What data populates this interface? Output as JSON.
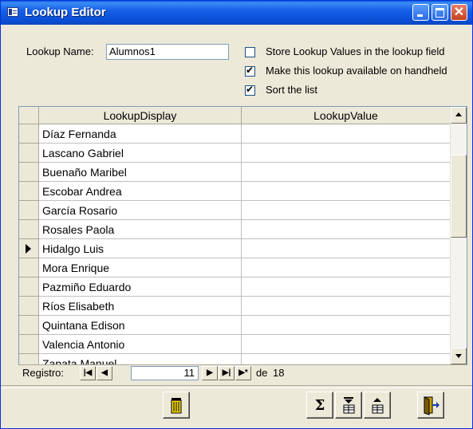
{
  "window": {
    "title": "Lookup Editor"
  },
  "form": {
    "lookup_name_label": "Lookup Name:",
    "lookup_name_value": "Alumnos1",
    "options": [
      {
        "label": "Store Lookup Values in the lookup field",
        "checked": false
      },
      {
        "label": "Make this lookup available on handheld",
        "checked": true
      },
      {
        "label": "Sort the list",
        "checked": true
      }
    ]
  },
  "grid": {
    "columns": [
      "LookupDisplay",
      "LookupValue"
    ],
    "rows": [
      {
        "display": "Díaz Fernanda",
        "value": ""
      },
      {
        "display": "Lascano Gabriel",
        "value": ""
      },
      {
        "display": "Buenaño Maribel",
        "value": ""
      },
      {
        "display": "Escobar Andrea",
        "value": ""
      },
      {
        "display": "García Rosario",
        "value": ""
      },
      {
        "display": "Rosales Paola",
        "value": ""
      },
      {
        "display": "Hidalgo Luis",
        "value": "",
        "current": true
      },
      {
        "display": "Mora Enrique",
        "value": ""
      },
      {
        "display": "Pazmiño Eduardo",
        "value": ""
      },
      {
        "display": "Ríos Elisabeth",
        "value": ""
      },
      {
        "display": "Quintana Edison",
        "value": ""
      },
      {
        "display": "Valencia Antonio",
        "value": ""
      },
      {
        "display": "Zapata Manuel",
        "value": ""
      }
    ]
  },
  "navigator": {
    "label": "Registro:",
    "current": "11",
    "of_label": "de",
    "total": "18",
    "buttons": [
      "first-record",
      "previous-record",
      "next-record",
      "last-record",
      "new-record"
    ]
  },
  "toolbar": {
    "buttons": [
      "trash-icon",
      "sum-icon",
      "move-down-icon",
      "move-up-icon",
      "exit-icon"
    ]
  }
}
